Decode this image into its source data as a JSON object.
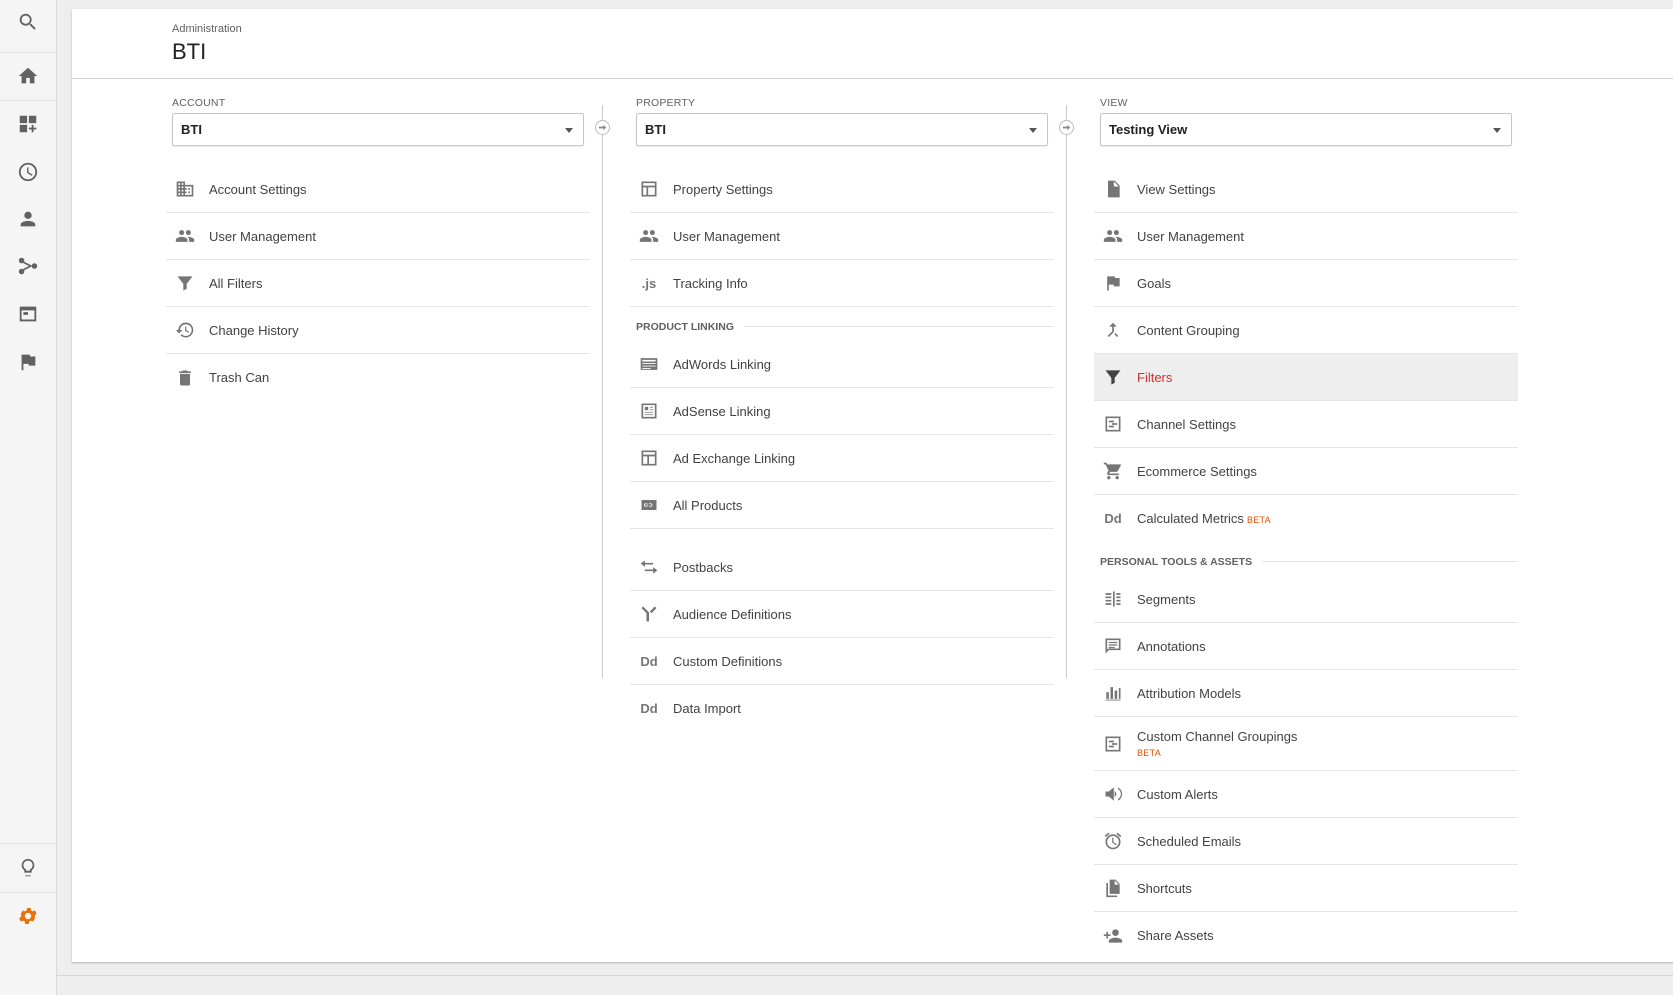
{
  "header": {
    "subtitle": "Administration",
    "title": "BTI"
  },
  "account": {
    "label": "ACCOUNT",
    "selected": "BTI",
    "items": [
      {
        "label": "Account Settings",
        "icon": "building-icon"
      },
      {
        "label": "User Management",
        "icon": "people-icon"
      },
      {
        "label": "All Filters",
        "icon": "filter-icon"
      },
      {
        "label": "Change History",
        "icon": "history-icon"
      },
      {
        "label": "Trash Can",
        "icon": "trash-icon"
      }
    ]
  },
  "property": {
    "label": "PROPERTY",
    "selected": "BTI",
    "items": [
      {
        "label": "Property Settings",
        "icon": "layout-icon"
      },
      {
        "label": "User Management",
        "icon": "people-icon"
      },
      {
        "label": "Tracking Info",
        "icon": "js-icon",
        "glyph": ".js"
      }
    ],
    "linking_heading": "PRODUCT LINKING",
    "linking": [
      {
        "label": "AdWords Linking",
        "icon": "adwords-icon"
      },
      {
        "label": "AdSense Linking",
        "icon": "adsense-icon"
      },
      {
        "label": "Ad Exchange Linking",
        "icon": "adexchange-icon"
      },
      {
        "label": "All Products",
        "icon": "link-icon"
      }
    ],
    "more": [
      {
        "label": "Postbacks",
        "icon": "swap-icon"
      },
      {
        "label": "Audience Definitions",
        "icon": "fork-icon"
      },
      {
        "label": "Custom Definitions",
        "icon": "dd-icon",
        "glyph": "Dd"
      },
      {
        "label": "Data Import",
        "icon": "dd-icon",
        "glyph": "Dd"
      }
    ]
  },
  "view": {
    "label": "VIEW",
    "selected": "Testing View",
    "items": [
      {
        "label": "View Settings",
        "icon": "file-icon"
      },
      {
        "label": "User Management",
        "icon": "people-icon"
      },
      {
        "label": "Goals",
        "icon": "flag-icon"
      },
      {
        "label": "Content Grouping",
        "icon": "merge-icon"
      },
      {
        "label": "Filters",
        "icon": "filter-icon",
        "active": true
      },
      {
        "label": "Channel Settings",
        "icon": "channel-icon"
      },
      {
        "label": "Ecommerce Settings",
        "icon": "cart-icon"
      },
      {
        "label": "Calculated Metrics",
        "icon": "dd-icon",
        "glyph": "Dd",
        "badge": "BETA"
      }
    ],
    "personal_heading": "PERSONAL TOOLS & ASSETS",
    "personal": [
      {
        "label": "Segments",
        "icon": "segments-icon"
      },
      {
        "label": "Annotations",
        "icon": "comment-icon"
      },
      {
        "label": "Attribution Models",
        "icon": "bars-icon"
      },
      {
        "label": "Custom Channel Groupings",
        "icon": "channel-icon",
        "badge": "BETA"
      },
      {
        "label": "Custom Alerts",
        "icon": "megaphone-icon"
      },
      {
        "label": "Scheduled Emails",
        "icon": "alarm-icon"
      },
      {
        "label": "Shortcuts",
        "icon": "copy-icon"
      },
      {
        "label": "Share Assets",
        "icon": "person-add-icon"
      }
    ]
  },
  "colors": {
    "accent": "#e8710a",
    "active_text": "#d32f2f"
  }
}
